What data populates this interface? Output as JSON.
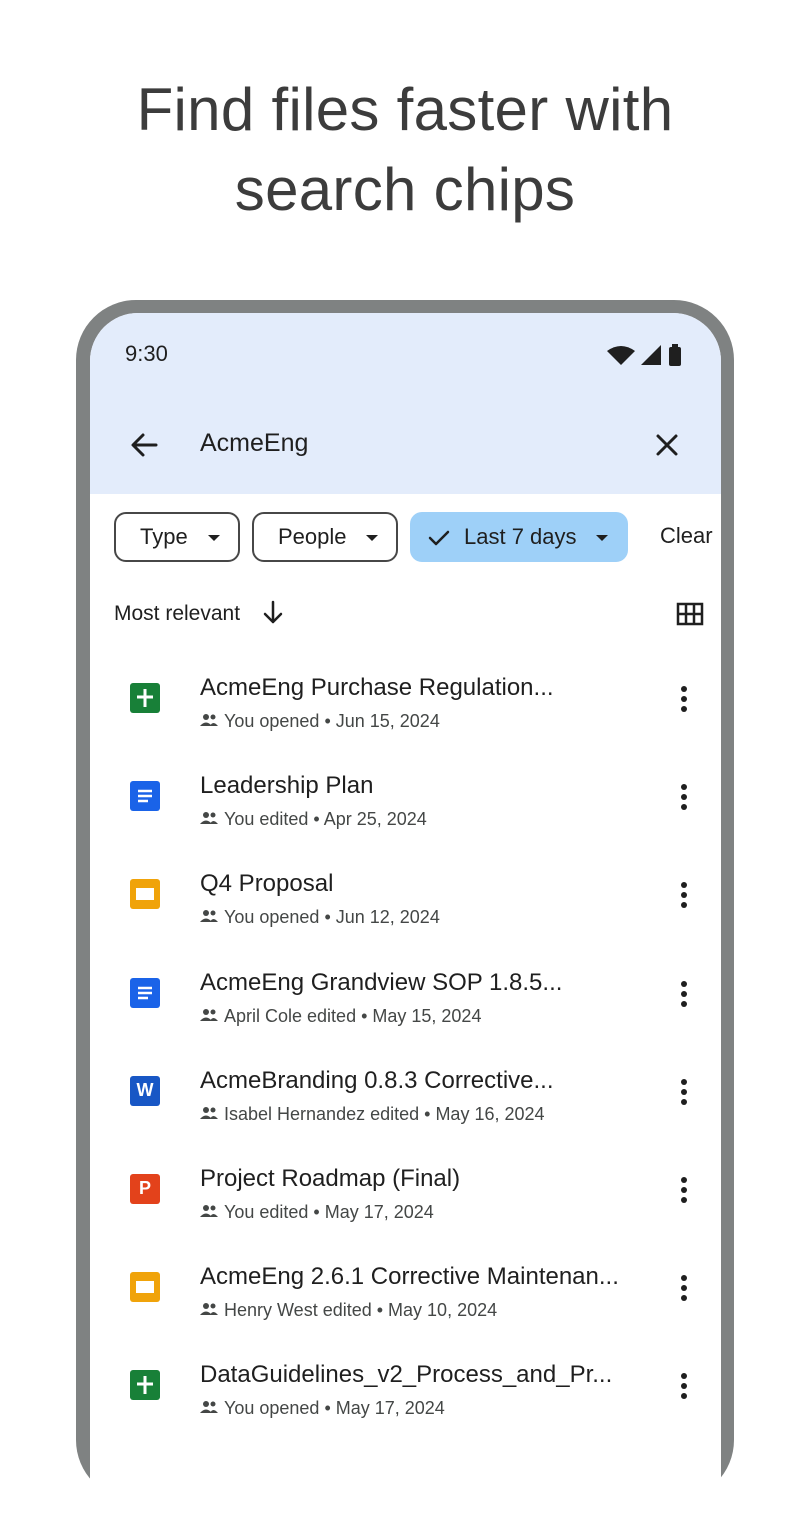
{
  "headline": {
    "line1": "Find files faster with",
    "line2": "search chips"
  },
  "status_bar": {
    "time": "9:30",
    "icons": [
      "wifi-icon",
      "signal-icon",
      "battery-icon"
    ]
  },
  "search": {
    "query": "AcmeEng",
    "back_icon": "arrow-back-icon",
    "close_icon": "close-icon"
  },
  "chips": {
    "type": "Type",
    "people": "People",
    "last_days": "Last 7 days",
    "clear": "Clear"
  },
  "sort": {
    "label": "Most relevant"
  },
  "files": [
    {
      "title": "AcmeEng Purchase Regulation...",
      "meta": "You opened • Jun 15, 2024",
      "type": "sheets"
    },
    {
      "title": "Leadership Plan",
      "meta": "You edited • Apr 25, 2024",
      "type": "docs"
    },
    {
      "title": "Q4 Proposal",
      "meta": "You opened • Jun 12, 2024",
      "type": "slides"
    },
    {
      "title": "AcmeEng Grandview SOP 1.8.5...",
      "meta": "April Cole edited • May 15, 2024",
      "type": "docs"
    },
    {
      "title": "AcmeBranding 0.8.3 Corrective...",
      "meta": "Isabel Hernandez edited • May 16, 2024",
      "type": "word"
    },
    {
      "title": "Project Roadmap (Final)",
      "meta": "You edited • May 17, 2024",
      "type": "powerpoint"
    },
    {
      "title": "AcmeEng 2.6.1 Corrective Maintenan...",
      "meta": "Henry West edited • May 10, 2024",
      "type": "slides"
    },
    {
      "title": "DataGuidelines_v2_Process_and_Pr...",
      "meta": "You opened • May 17, 2024",
      "type": "sheets"
    }
  ],
  "colors": {
    "header_bg": "#e3ecfb",
    "chip_active": "#9ed0f8",
    "sheets": "#188038",
    "docs": "#1a63e8",
    "slides": "#f0a30a",
    "word": "#1857c5",
    "powerpoint": "#e3421b"
  }
}
